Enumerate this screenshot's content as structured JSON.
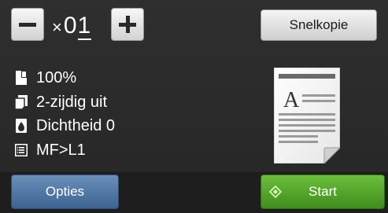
{
  "copy_count": {
    "times_symbol": "×",
    "digits": [
      "0",
      "1"
    ]
  },
  "buttons": {
    "minus_icon": "minus-icon",
    "plus_icon": "plus-icon",
    "snelkopie_label": "Snelkopie",
    "opties_label": "Opties",
    "start_label": "Start"
  },
  "settings": [
    {
      "icon": "enlarge-reduce-icon",
      "label": "100%"
    },
    {
      "icon": "duplex-icon",
      "label": "2-zijdig uit"
    },
    {
      "icon": "density-drop-icon",
      "label": "Dichtheid 0"
    },
    {
      "icon": "tray-list-icon",
      "label": "MF>L1"
    }
  ],
  "preview": {
    "letter": "A",
    "icon": "document-preview-icon"
  },
  "colors": {
    "opties_blue": "#4a6f9e",
    "start_green": "#4f9f28"
  }
}
